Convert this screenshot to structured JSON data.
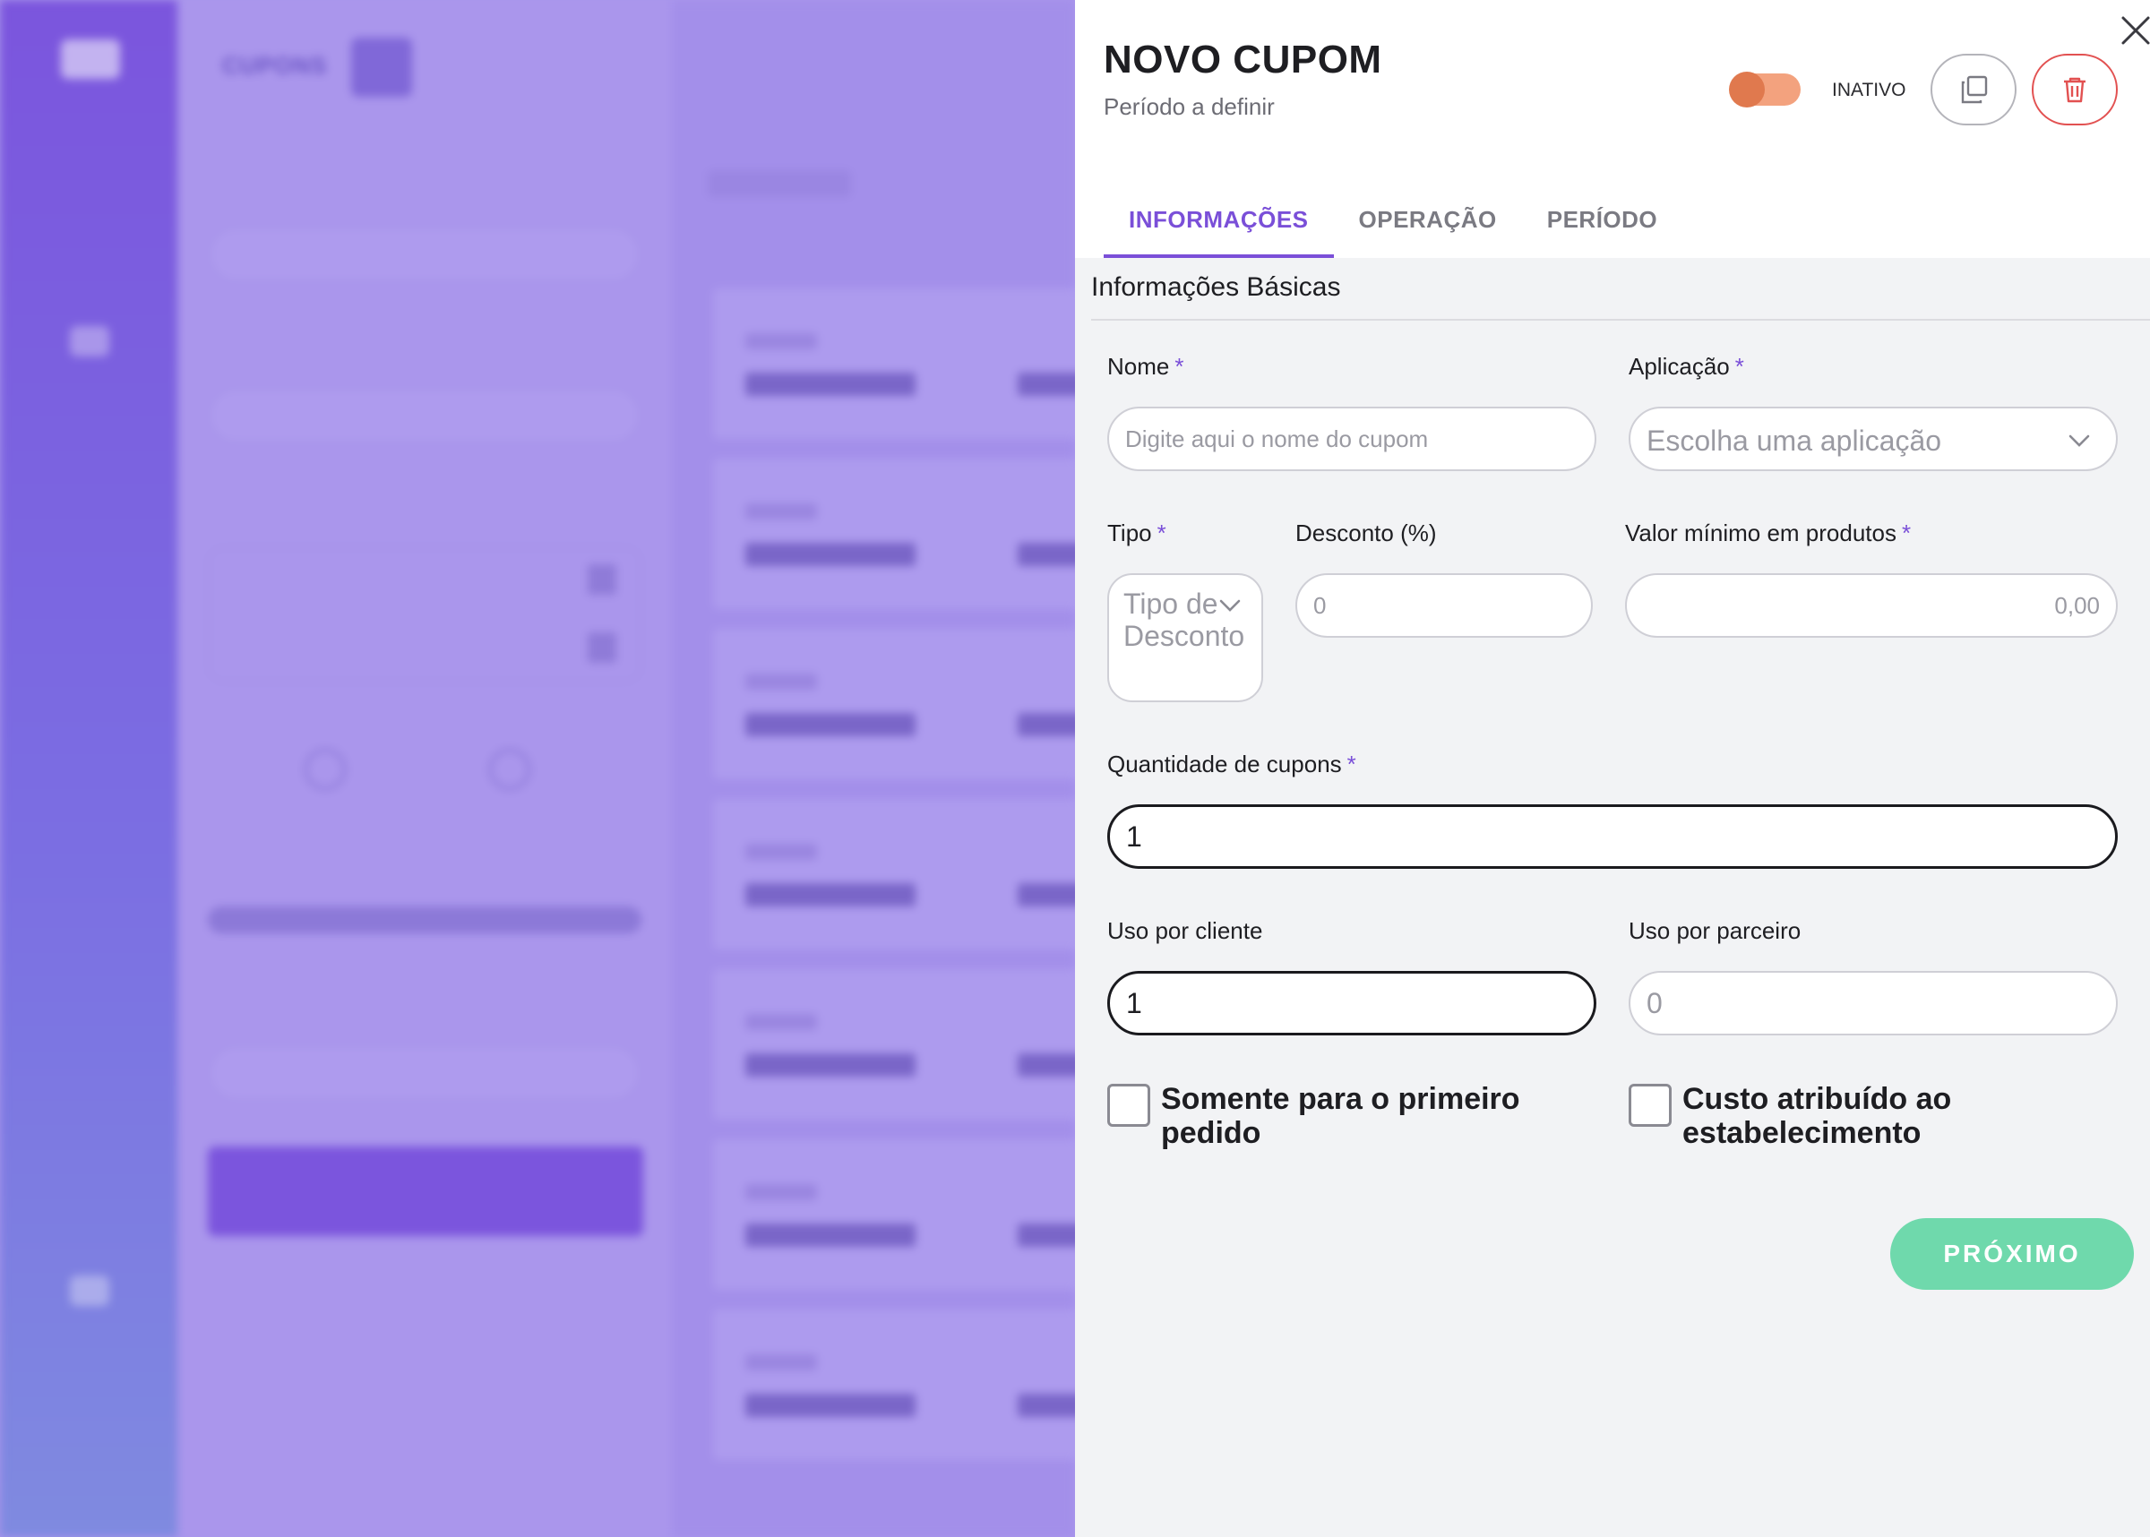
{
  "background": {
    "page_title": "CUPONS"
  },
  "drawer": {
    "title": "NOVO CUPOM",
    "subtitle": "Período a definir",
    "status_label": "INATIVO",
    "tabs": [
      {
        "label": "INFORMAÇÕES",
        "active": true
      },
      {
        "label": "OPERAÇÃO",
        "active": false
      },
      {
        "label": "PERÍODO",
        "active": false
      }
    ],
    "section_title": "Informações Básicas",
    "required_mark": "*",
    "fields": {
      "nome": {
        "label": "Nome",
        "placeholder": "Digite aqui o nome do cupom",
        "value": ""
      },
      "aplicacao": {
        "label": "Aplicação",
        "placeholder": "Escolha uma aplicação"
      },
      "tipo": {
        "label": "Tipo",
        "placeholder": "Tipo de Desconto"
      },
      "desconto": {
        "label": "Desconto (%)",
        "placeholder": "0",
        "value": ""
      },
      "valor_minimo": {
        "label": "Valor mínimo em produtos",
        "placeholder": "0,00",
        "value": ""
      },
      "quantidade": {
        "label": "Quantidade de cupons",
        "value": "1"
      },
      "uso_cliente": {
        "label": "Uso por cliente",
        "value": "1"
      },
      "uso_parceiro": {
        "label": "Uso por parceiro",
        "placeholder": "0",
        "value": ""
      }
    },
    "checkboxes": {
      "primeiro_pedido": {
        "label": "Somente para o primeiro pedido",
        "checked": false
      },
      "custo_estabelecimento": {
        "label": "Custo atribuído ao estabelecimento",
        "checked": false
      }
    },
    "next_button": "PRÓXIMO"
  },
  "icons": {
    "close": "close-icon",
    "copy": "copy-icon",
    "trash": "trash-icon",
    "chevron": "chevron-down-icon"
  },
  "colors": {
    "accent": "#7a4fd8",
    "toggle_track": "#f3a27e",
    "toggle_knob": "#e0794e",
    "danger": "#e25151",
    "success": "#6fd9ac"
  }
}
